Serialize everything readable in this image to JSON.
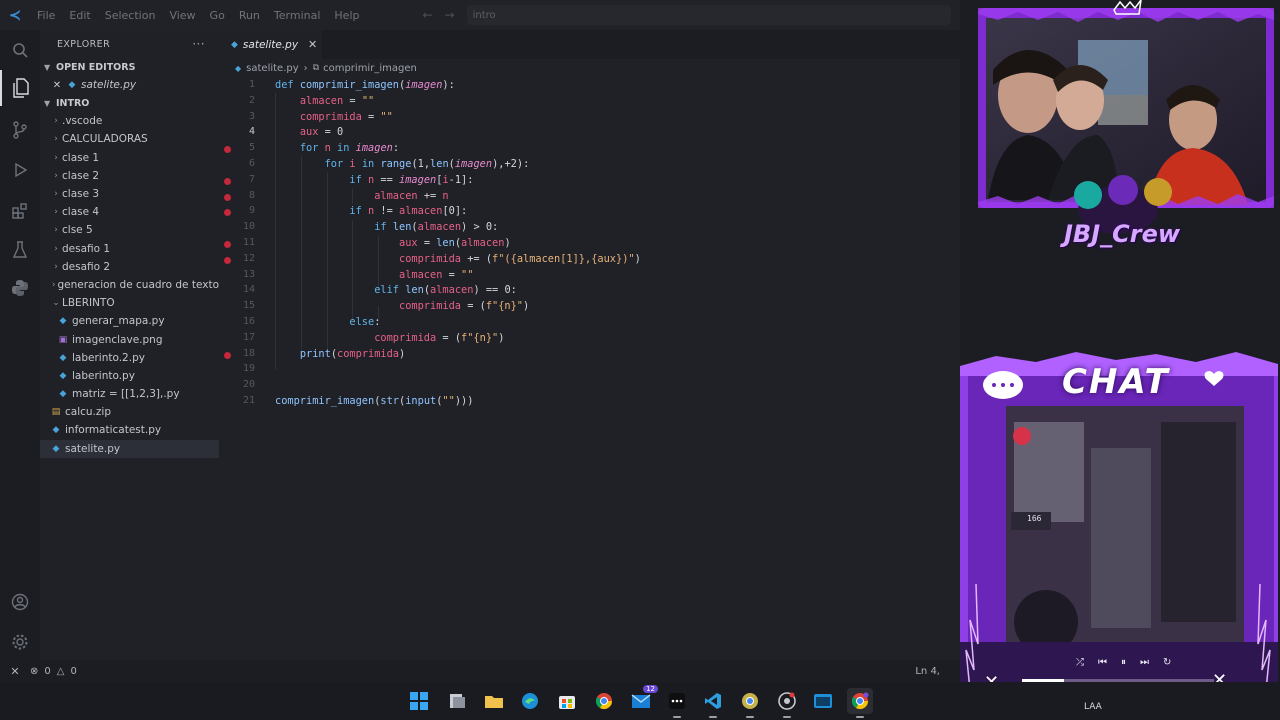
{
  "titlebar": {
    "menu": [
      "File",
      "Edit",
      "Selection",
      "View",
      "Go",
      "Run",
      "Terminal",
      "Help"
    ],
    "search_text": "intro"
  },
  "activity": [
    "files-icon",
    "search-icon",
    "source-control-icon",
    "run-debug-icon",
    "extensions-icon",
    "testing-icon",
    "python-icon",
    "account-icon",
    "settings-icon"
  ],
  "sidebar": {
    "title": "EXPLORER",
    "open_editors_label": "OPEN EDITORS",
    "open_editor_file": "satelite.py",
    "folder_label": "INTRO",
    "items": [
      {
        "label": ".vscode",
        "kind": "folder"
      },
      {
        "label": "CALCULADORAS",
        "kind": "folder"
      },
      {
        "label": "clase 1",
        "kind": "folder"
      },
      {
        "label": "clase 2",
        "kind": "folder"
      },
      {
        "label": "clase 3",
        "kind": "folder"
      },
      {
        "label": "clase 4",
        "kind": "folder"
      },
      {
        "label": "clse 5",
        "kind": "folder"
      },
      {
        "label": "desafio 1",
        "kind": "folder"
      },
      {
        "label": "desafio 2",
        "kind": "folder"
      },
      {
        "label": "generacion de cuadro de texto",
        "kind": "folder"
      },
      {
        "label": "LBERINTO",
        "kind": "folder-open"
      },
      {
        "label": "generar_mapa.py",
        "kind": "py-nested"
      },
      {
        "label": "imagenclave.png",
        "kind": "png-nested"
      },
      {
        "label": "laberinto.2.py",
        "kind": "py-nested"
      },
      {
        "label": "laberinto.py",
        "kind": "py-nested"
      },
      {
        "label": "matriz = [[1,2,3],.py",
        "kind": "py-nested"
      },
      {
        "label": "calcu.zip",
        "kind": "zip"
      },
      {
        "label": "informaticatest.py",
        "kind": "py"
      },
      {
        "label": "satelite.py",
        "kind": "py-selected"
      }
    ]
  },
  "editor": {
    "tab_label": "satelite.py",
    "breadcrumb_file": "satelite.py",
    "breadcrumb_symbol": "comprimir_imagen",
    "current_line": 4,
    "breakpoints": [
      5,
      7,
      8,
      9,
      11,
      12,
      18
    ],
    "lines": [
      "def comprimir_imagen(imagen):",
      "    almacen = \"\"",
      "    comprimida = \"\"",
      "    aux = 0",
      "    for n in imagen:",
      "        for i in range(1,len(imagen),+2):",
      "            if n == imagen[i-1]:",
      "                almacen += n",
      "            if n != almacen[0]:",
      "                if len(almacen) > 0:",
      "                    aux = len(almacen)",
      "                    comprimida += (f\"({almacen[1]},{aux})\")",
      "                    almacen = \"\"",
      "                elif len(almacen) == 0:",
      "                    comprimida = (f\"{n}\")",
      "            else:",
      "                comprimida = (f\"{n}\")",
      "    print(comprimida)",
      "",
      "",
      "comprimir_imagen(str(input(\"\")))"
    ]
  },
  "status": {
    "errors": "0",
    "warnings": "0",
    "position": "Ln 4,"
  },
  "overlay": {
    "crew_name": "JBJ_Crew",
    "chat_title": "CHAT",
    "plate": "166"
  },
  "taskbar": {
    "apps": [
      "windows-start-icon",
      "file-manager-icon",
      "folder-icon",
      "edge-icon",
      "store-icon",
      "chrome-icon",
      "mail-icon",
      "tiktok-icon",
      "vscode-icon",
      "chrome-dev-icon",
      "chrome-canary-icon",
      "terminal-icon",
      "chrome-profile-icon"
    ],
    "mail_badge": "12",
    "lang": "LAA"
  }
}
